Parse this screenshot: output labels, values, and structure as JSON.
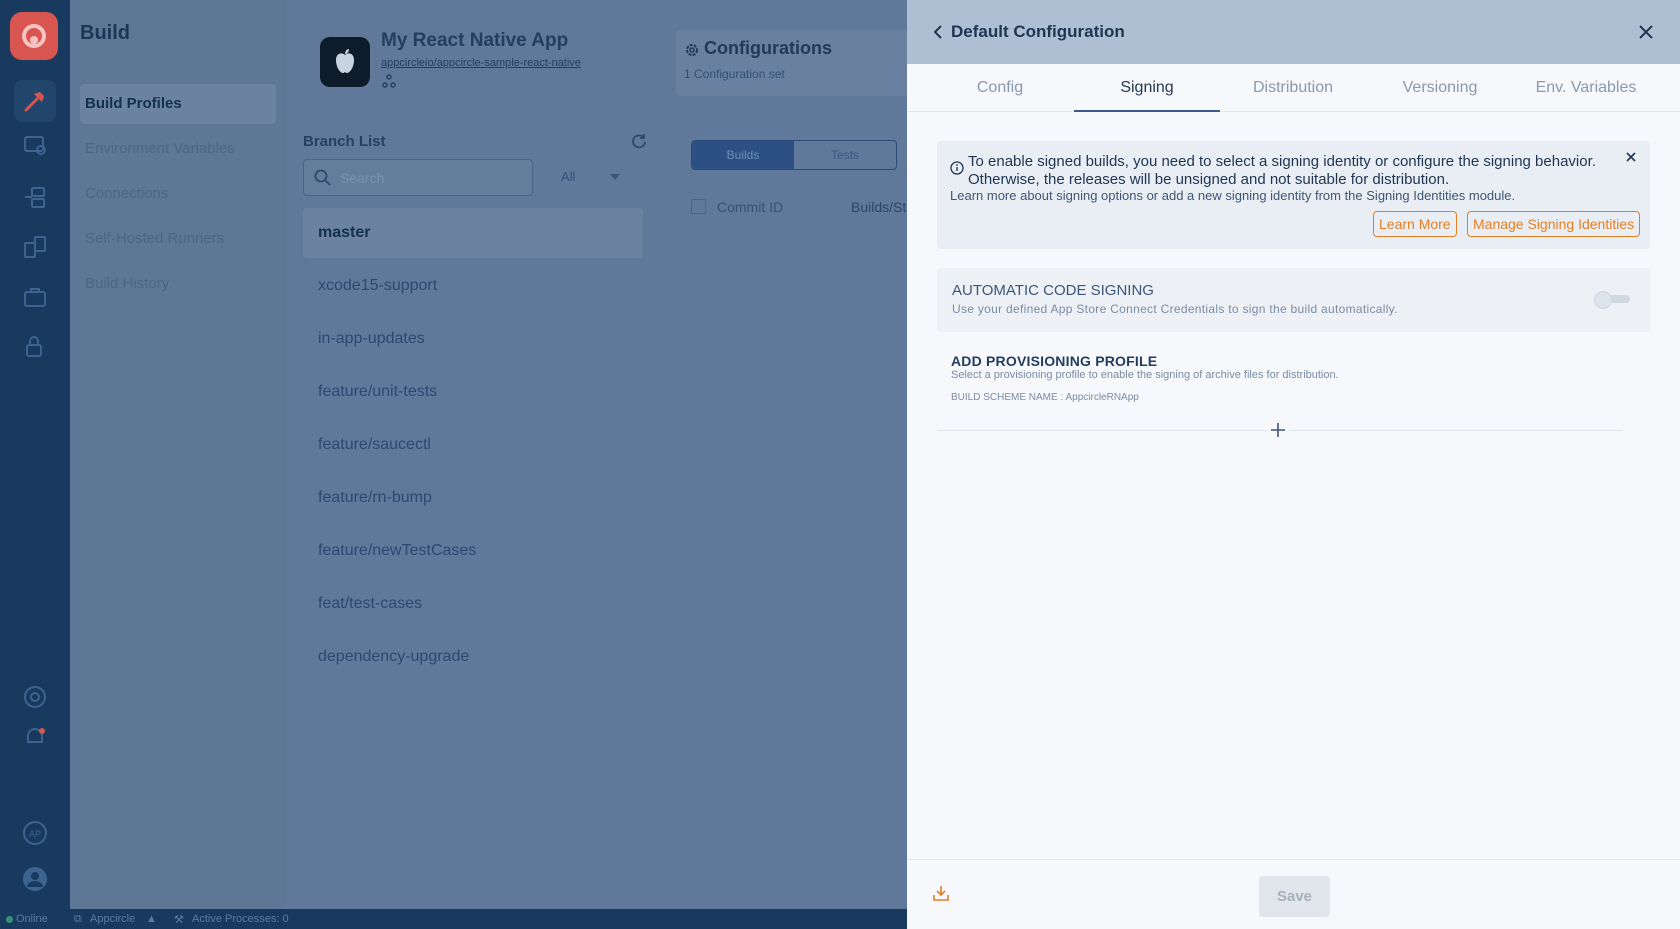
{
  "nav": {
    "title": "Build",
    "items": [
      {
        "label": "Build Profiles",
        "active": true
      },
      {
        "label": "Environment Variables",
        "active": false
      },
      {
        "label": "Connections",
        "active": false
      },
      {
        "label": "Self-Hosted Runners",
        "active": false
      },
      {
        "label": "Build History",
        "active": false
      }
    ]
  },
  "rail_icons": [
    "build-hammer-icon",
    "distribute-icon",
    "publish-icon",
    "testing-icon",
    "enterprise-store-icon",
    "signing-identities-icon",
    "help-icon",
    "notifications-bell-icon",
    "org-avatar-icon",
    "user-avatar-icon"
  ],
  "app": {
    "name": "My React Native App",
    "repo": "appcircleio/appcircle-sample-react-native",
    "platform_icon": "apple-icon"
  },
  "configurations": {
    "title": "Configurations",
    "subtitle": "1 Configuration set"
  },
  "branches": {
    "title": "Branch List",
    "search_placeholder": "Search",
    "filter_value": "All",
    "items": [
      {
        "name": "master",
        "active": true
      },
      {
        "name": "xcode15-support",
        "active": false
      },
      {
        "name": "in-app-updates",
        "active": false
      },
      {
        "name": "feature/unit-tests",
        "active": false
      },
      {
        "name": "feature/saucectl",
        "active": false
      },
      {
        "name": "feature/rn-bump",
        "active": false
      },
      {
        "name": "feature/newTestCases",
        "active": false
      },
      {
        "name": "feat/test-cases",
        "active": false
      },
      {
        "name": "dependency-upgrade",
        "active": false
      }
    ]
  },
  "commits": {
    "segments": [
      "Builds",
      "Tests"
    ],
    "active_segment": "Builds",
    "col_commit": "Commit ID",
    "col_builds": "Builds/St"
  },
  "status_bar": {
    "online": "Online",
    "org": "Appcircle",
    "processes": "Active Processes: 0"
  },
  "drawer": {
    "title": "Default Configuration",
    "tabs": [
      "Config",
      "Signing",
      "Distribution",
      "Versioning",
      "Env. Variables"
    ],
    "active_tab": "Signing",
    "alert": {
      "line1": "To enable signed builds, you need to select a signing identity or configure the signing behavior. Otherwise, the releases will be unsigned and not suitable for distribution.",
      "line2": "Learn more about signing options or add a new signing identity from the Signing Identities module.",
      "learn_more": "Learn More",
      "manage": "Manage Signing Identities"
    },
    "auto_signing": {
      "title": "AUTOMATIC CODE SIGNING",
      "description": "Use your defined App Store Connect Credentials to sign the build automatically.",
      "enabled": false
    },
    "provisioning": {
      "title": "ADD PROVISIONING PROFILE",
      "description": "Select a provisioning profile to enable the signing of archive files for distribution.",
      "scheme": "BUILD SCHEME NAME : AppcircleRNApp"
    },
    "save_label": "Save"
  },
  "colors": {
    "accent_orange": "#e67e22",
    "rail_bg": "#183a5f",
    "drawer_header": "#aebfd3"
  }
}
